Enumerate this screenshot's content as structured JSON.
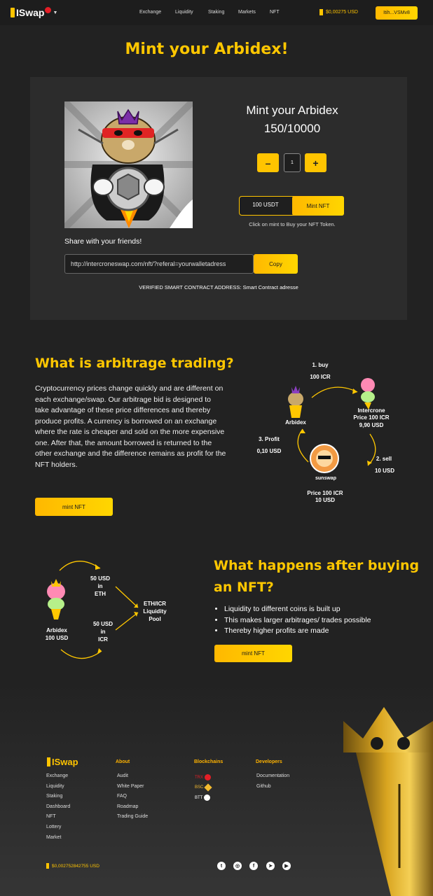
{
  "header": {
    "logo_text": "ISwap",
    "nav": [
      "Exchange",
      "Liquidity",
      "Staking",
      "Markets",
      "NFT"
    ],
    "price": "$0,00275 USD",
    "wallet_button": "Itih...VSMv8"
  },
  "page_title": "Mint your Arbidex!",
  "mint": {
    "title": "Mint your Arbidex",
    "count": "150/10000",
    "minus": "–",
    "quantity": "1",
    "plus": "+",
    "price": "100 USDT",
    "mint_button": "Mint NFT",
    "note": "Click on mint to Buy your NFT Token.",
    "share_label": "Share with your friends!",
    "share_url": "http://intercroneswap.com/nft/?referal=yourwalletadress",
    "copy_button": "Copy",
    "contract_line": "VERIFIED SMART CONTRACT ADDRESS: Smart Contract adresse"
  },
  "arbitrage": {
    "heading": "What is arbitrage trading?",
    "body": "Cryptocurrency prices change quickly and are different on each exchange/swap. Our arbitrage bid is designed to take advantage of these price differences and thereby produce profits. A currency is borrowed on an exchange where the rate is cheaper and sold on the more expensive one. After that, the amount borrowed is returned to the other exchange and the difference remains as profit for the NFT holders.",
    "button": "mint NFT",
    "diagram": {
      "step1": "1. buy",
      "step1_amount": "100 ICR",
      "node_left": "Arbidex",
      "node_right_name": "Intercrone",
      "node_right_price": "Price 100 ICR",
      "node_right_usd": "9,90 USD",
      "step2": "2. sell",
      "step2_amount": "10 USD",
      "node_bottom": "sunswap",
      "node_bottom_price": "Price 100 ICR",
      "node_bottom_usd": "10 USD",
      "step3": "3. Profit",
      "step3_amount": "0,10 USD"
    }
  },
  "after": {
    "heading_line1": "What happens after buying",
    "heading_line2": "an NFT?",
    "bullets": [
      "Liquidity to different coins is built up",
      "This makes larger arbitrages/ trades possible",
      "Thereby higher profits are made"
    ],
    "button": "mint NFT",
    "diagram": {
      "top_line1": "50 USD",
      "top_line2": "in",
      "top_line3": "ETH",
      "bottom_line1": "50 USD",
      "bottom_line2": "in",
      "bottom_line3": "ICR",
      "pool_line1": "ETH/ICR",
      "pool_line2": "Liquidity",
      "pool_line3": "Pool",
      "node_name": "Arbidex",
      "node_value": "100 USD"
    }
  },
  "footer": {
    "logo_text": "ISwap",
    "col1": [
      "Exchange",
      "Liquidity",
      "Staking",
      "Dashboard",
      "NFT",
      "Lottery",
      "Market"
    ],
    "about_title": "About",
    "about": [
      "Audit",
      "White Paper",
      "FAQ",
      "Roadmap",
      "Trading Guide"
    ],
    "chains_title": "Blockchains",
    "chains": [
      "TRX",
      "BSC",
      "BTT"
    ],
    "dev_title": "Developers",
    "dev": [
      "Documentation",
      "Github"
    ],
    "price": "$0,002752842755 USD"
  },
  "colors": {
    "accent": "#ffc700",
    "background": "#222222",
    "card": "#2c2c2c"
  }
}
